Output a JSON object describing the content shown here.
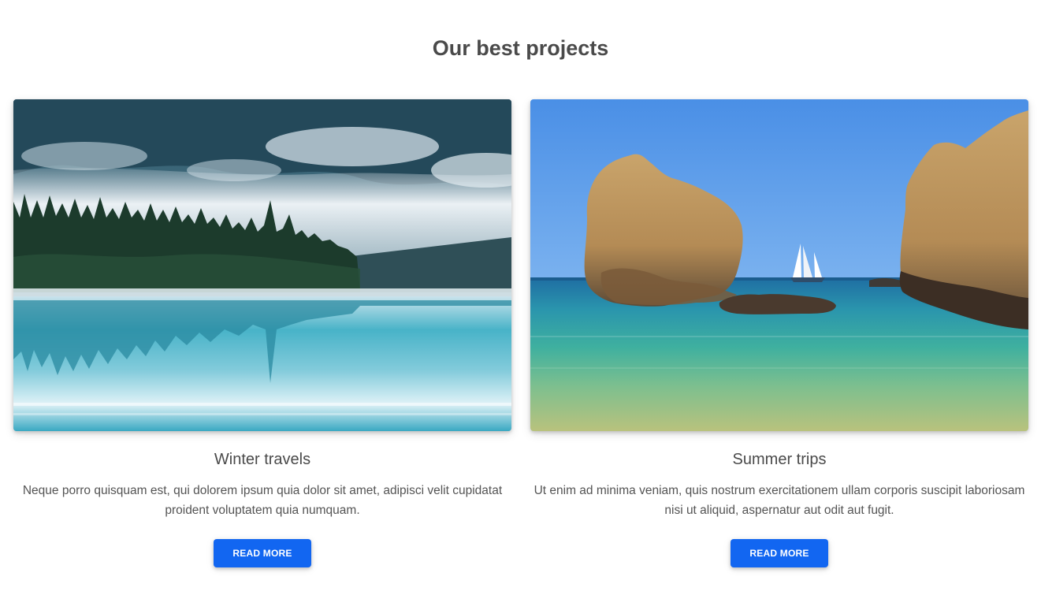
{
  "section": {
    "title": "Our best projects"
  },
  "cards": [
    {
      "image": "winter-lake-forest-image",
      "title": "Winter travels",
      "text": "Neque porro quisquam est, qui dolorem ipsum quia dolor sit amet, adipisci velit cupidatat proident voluptatem quia numquam.",
      "button": "Read more"
    },
    {
      "image": "summer-beach-rocks-image",
      "title": "Summer trips",
      "text": "Ut enim ad minima veniam, quis nostrum exercitationem ullam corporis suscipit laboriosam nisi ut aliquid, aspernatur aut odit aut fugit.",
      "button": "Read more"
    }
  ],
  "colors": {
    "accent": "#1266f1",
    "heading": "#4a4a4a",
    "body_text": "#545454"
  }
}
